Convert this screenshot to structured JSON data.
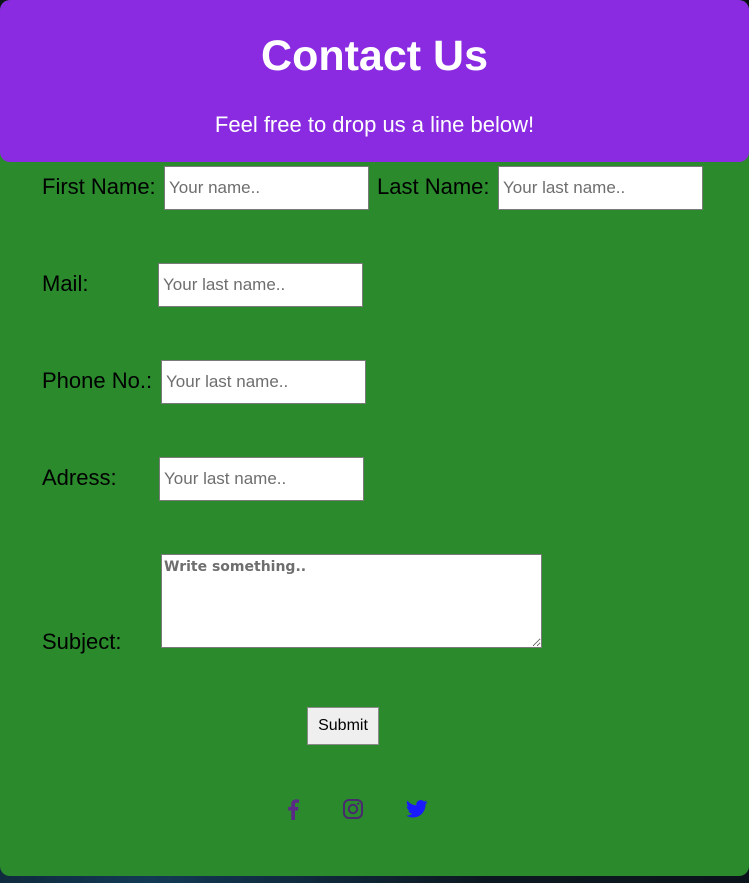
{
  "header": {
    "title": "Contact Us",
    "subtitle": "Feel free to drop us a line below!"
  },
  "form": {
    "first_name": {
      "label": "First Name:",
      "placeholder": "Your name.."
    },
    "last_name": {
      "label": "Last Name:",
      "placeholder": "Your last name.."
    },
    "mail": {
      "label": "Mail:",
      "placeholder": "Your last name.."
    },
    "phone": {
      "label": "Phone No.:",
      "placeholder": "Your last name.."
    },
    "address": {
      "label": "Adress:",
      "placeholder": "Your last name.."
    },
    "subject": {
      "label": "Subject:",
      "placeholder": "Write something.."
    },
    "submit_label": "Submit"
  },
  "social": [
    {
      "icon": "facebook-icon",
      "color": "#5b2a86"
    },
    {
      "icon": "instagram-icon",
      "color": "#4a2a6e"
    },
    {
      "icon": "twitter-icon",
      "color": "#1a1aff"
    }
  ],
  "colors": {
    "header_bg": "#8a2be2",
    "form_bg": "#2a8a2c"
  }
}
